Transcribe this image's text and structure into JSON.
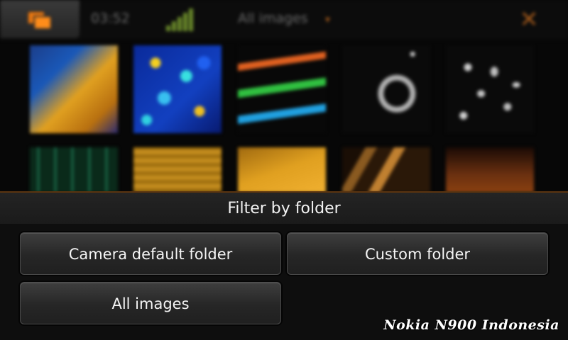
{
  "status_bar": {
    "clock": "03:52",
    "view_title": "All images",
    "switcher_icon": "task-switcher-icon",
    "signal_icon": "signal-strength-icon",
    "dropdown_icon": "chevron-down-icon",
    "close_icon": "close-icon"
  },
  "dialog": {
    "title": "Filter by folder",
    "buttons": {
      "camera_default": "Camera default folder",
      "custom": "Custom folder",
      "all_images": "All images"
    }
  },
  "watermark": "Nokia N900 Indonesia",
  "colors": {
    "accent": "#f07a10",
    "dialog_bg": "#0e0e0e",
    "button_text": "#f4f4f4"
  }
}
